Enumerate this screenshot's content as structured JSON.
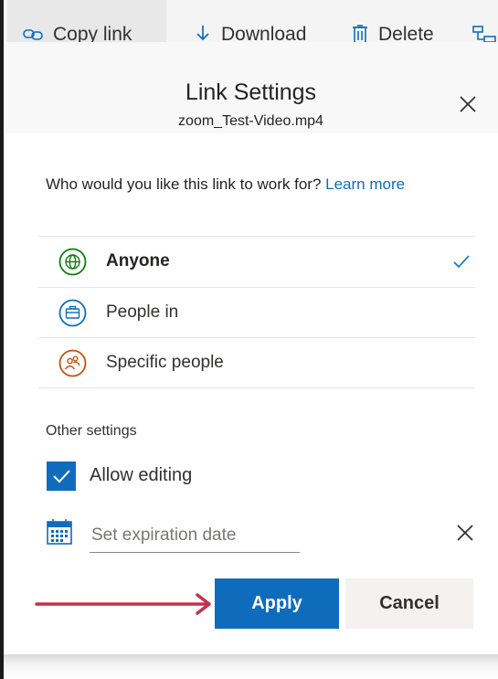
{
  "toolbar": {
    "copy_link": "Copy link",
    "download": "Download",
    "delete": "Delete"
  },
  "panel": {
    "title": "Link Settings",
    "file_name": "zoom_Test-Video.mp4",
    "question": "Who would you like this link to work for?",
    "learn_more": "Learn more",
    "options": [
      {
        "label": "Anyone",
        "icon": "globe-icon",
        "selected": true
      },
      {
        "label": "People in",
        "icon": "briefcase-icon",
        "selected": false
      },
      {
        "label": "Specific people",
        "icon": "people-icon",
        "selected": false
      }
    ],
    "other_settings": "Other settings",
    "allow_editing": {
      "label": "Allow editing",
      "checked": true
    },
    "expiration": {
      "placeholder": "Set expiration date",
      "value": ""
    },
    "apply": "Apply",
    "cancel": "Cancel"
  },
  "colors": {
    "accent": "#0f6cbd",
    "anyone": "#107c10",
    "people_in": "#0f6cbd",
    "specific": "#ca5010",
    "annotation_arrow": "#c4314b"
  }
}
